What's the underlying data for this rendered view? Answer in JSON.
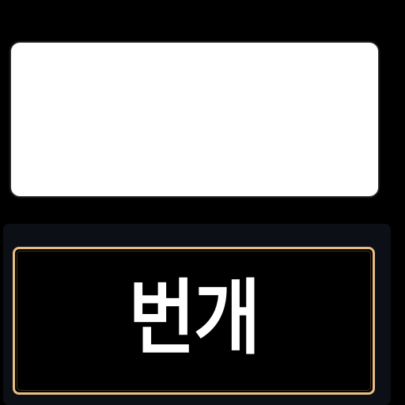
{
  "card": {
    "word_label": "번개"
  },
  "colors": {
    "background": "#000000",
    "image_slot": "#ffffff",
    "button_border": "#e7be82",
    "label_text": "#ffffff"
  }
}
